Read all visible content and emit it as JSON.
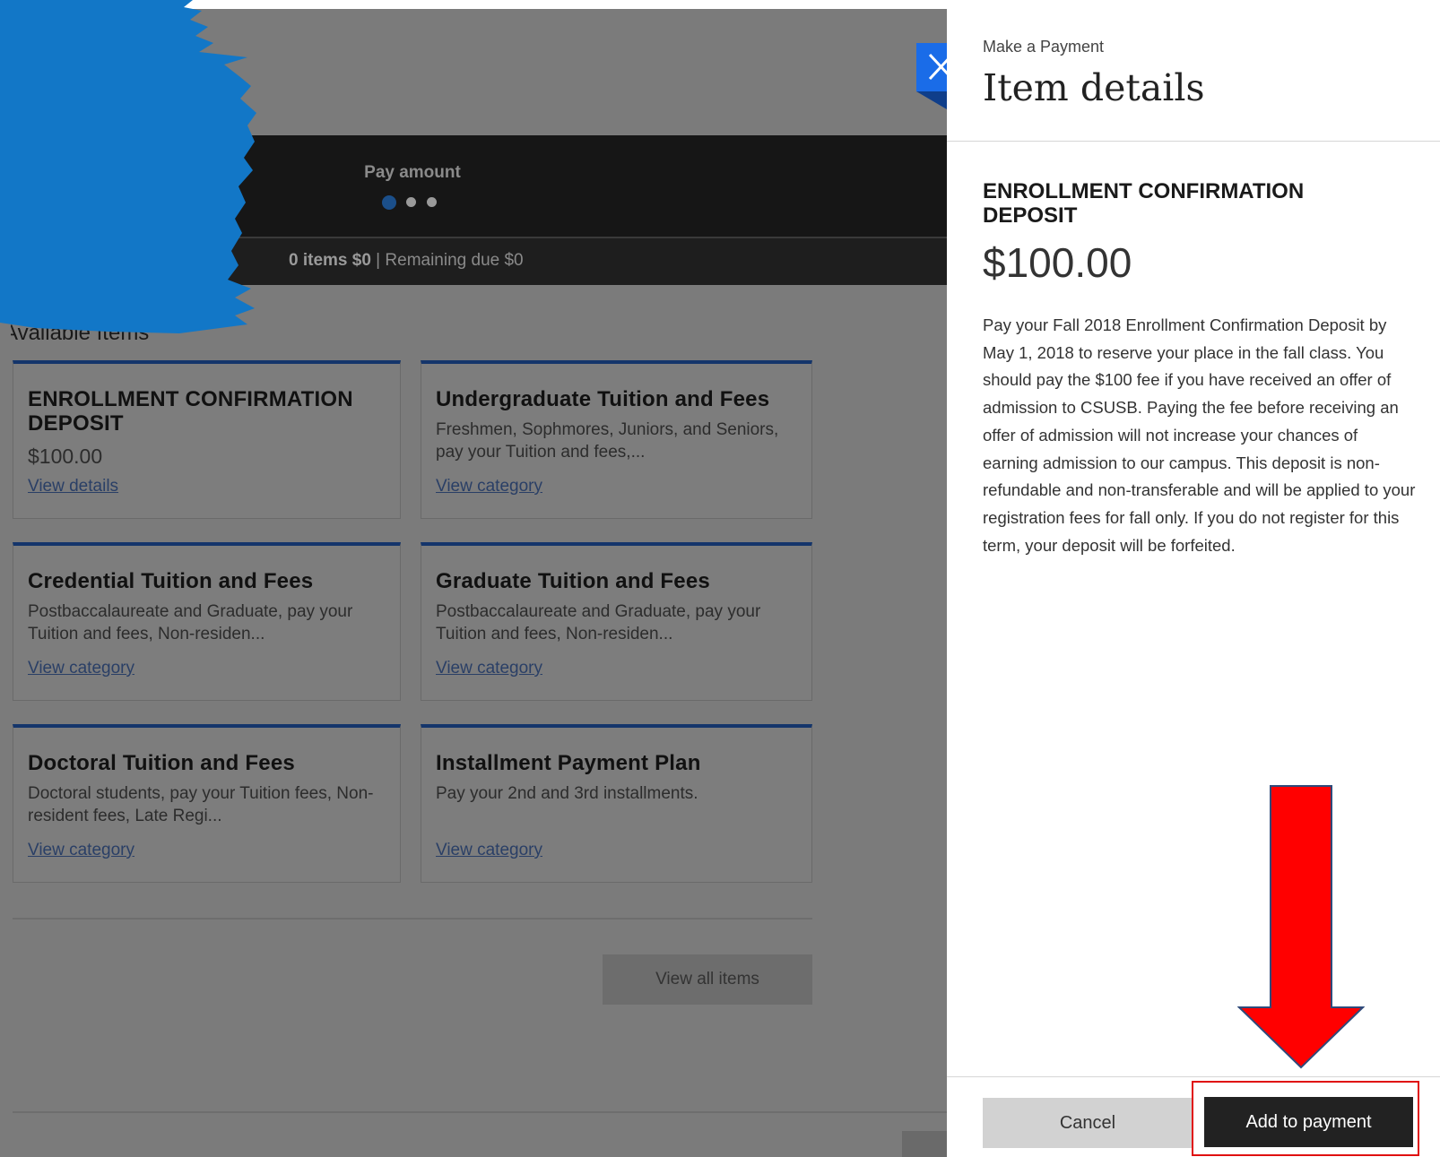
{
  "progress": {
    "step_label": "Pay amount",
    "summary_count": "0 items $0",
    "summary_separator": " | ",
    "summary_remaining": "Remaining due $0"
  },
  "section": {
    "heading": "Available Items"
  },
  "cards": [
    {
      "title": "ENROLLMENT CONFIRMATION DEPOSIT",
      "price": "$100.00",
      "link": "View details"
    },
    {
      "title": "Undergraduate Tuition and Fees",
      "desc": "Freshmen, Sophmores, Juniors, and Seniors, pay your Tuition and fees,...",
      "link": "View category"
    },
    {
      "title": "Credential Tuition and Fees",
      "desc": "Postbaccalaureate and Graduate, pay your Tuition and fees, Non-residen...",
      "link": "View category"
    },
    {
      "title": "Graduate Tuition and Fees",
      "desc": "Postbaccalaureate and Graduate, pay your Tuition and fees, Non-residen...",
      "link": "View category"
    },
    {
      "title": "Doctoral Tuition and Fees",
      "desc": "Doctoral students, pay your Tuition fees, Non-resident fees, Late Regi...",
      "link": "View category"
    },
    {
      "title": "Installment Payment Plan",
      "desc": "Pay your 2nd and 3rd installments.",
      "link": "View category"
    }
  ],
  "view_all_label": "View all items",
  "panel": {
    "kicker": "Make a Payment",
    "title": "Item details",
    "item_name": "ENROLLMENT CONFIRMATION DEPOSIT",
    "item_amount": "$100.00",
    "item_description": "Pay your Fall 2018 Enrollment Confirmation Deposit by May 1, 2018 to reserve your place in the fall class. You should pay the $100 fee if you have received an offer of admission to CSUSB. Paying the fee before receiving an offer of admission will not increase your chances of earning admission to our campus. This deposit is non-refundable and non-transferable and will be applied to your registration fees for fall only. If you do not register for this term, your deposit will be forfeited.",
    "cancel_label": "Cancel",
    "add_label": "Add to payment"
  },
  "icons": {
    "close": "close-icon",
    "annotation_arrow": "arrow-down-icon"
  },
  "colors": {
    "accent_blue": "#1a6ce8",
    "card_border": "#14356b",
    "redaction_blue": "#1277c7",
    "annotation_red": "#ff0000",
    "primary_button": "#222222"
  }
}
